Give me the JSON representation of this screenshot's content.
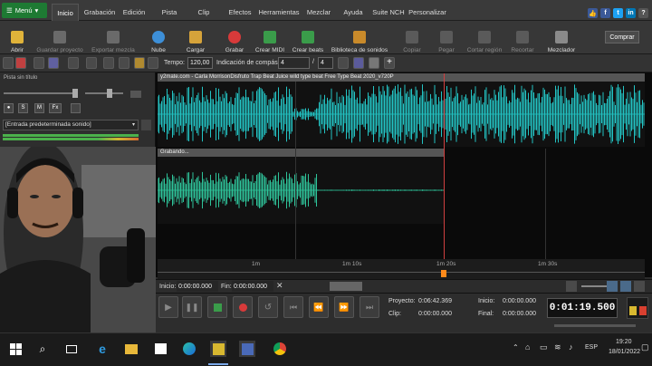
{
  "menubar": {
    "menu_label": "Menú",
    "tabs": [
      "Inicio",
      "Grabación",
      "Edición",
      "Pista",
      "Clip",
      "Efectos",
      "Herramientas",
      "Mezclar",
      "Ayuda",
      "Suite NCH",
      "Personalizar"
    ],
    "active_tab": "Inicio"
  },
  "ribbon": {
    "buttons": [
      {
        "label": "Abrir",
        "icon": "folder-open-icon",
        "enabled": true
      },
      {
        "label": "Guardar proyecto",
        "icon": "save-icon",
        "enabled": false
      },
      {
        "label": "Exportar mezcla",
        "icon": "export-icon",
        "enabled": false
      },
      {
        "label": "Nube",
        "icon": "cloud-icon",
        "enabled": true
      },
      {
        "label": "Cargar",
        "icon": "load-icon",
        "enabled": true
      },
      {
        "label": "Grabar",
        "icon": "record-icon",
        "enabled": true
      },
      {
        "label": "Crear MIDI",
        "icon": "midi-icon",
        "enabled": true
      },
      {
        "label": "Crear beats",
        "icon": "beats-icon",
        "enabled": true
      },
      {
        "label": "Biblioteca de sonidos",
        "icon": "sound-library-icon",
        "enabled": true
      },
      {
        "label": "Copiar",
        "icon": "copy-icon",
        "enabled": false
      },
      {
        "label": "Pegar",
        "icon": "paste-icon",
        "enabled": false
      },
      {
        "label": "Cortar región",
        "icon": "cut-region-icon",
        "enabled": false
      },
      {
        "label": "Recortar",
        "icon": "trim-icon",
        "enabled": false
      },
      {
        "label": "Mezclador",
        "icon": "mixer-icon",
        "enabled": true
      }
    ],
    "buy_label": "Comprar"
  },
  "toolbar": {
    "tempo_label": "Tempo:",
    "tempo_value": "120,00",
    "time_sig_label": "Indicación de compás:",
    "time_sig_num": "4",
    "time_sig_sep": "/",
    "time_sig_den": "4"
  },
  "left_panel": {
    "track_name": "Pista sin título",
    "input_device": "[Entrada predeterminada sonido]",
    "fx_label": "Fx",
    "solo_label": "S",
    "mute_label": "M"
  },
  "tracks": [
    {
      "title": "y2mate.com - Carla MorrisonDisfruto Trap Beat  Juice wild type beat  Free Type Beat 2020_v720P",
      "color": "#23c4c4"
    },
    {
      "title": "Grabando...",
      "color": "#2ec49a"
    }
  ],
  "ruler": {
    "labels": [
      "1m",
      "1m 10s",
      "1m 20s",
      "1m 30s"
    ]
  },
  "selection": {
    "start_label": "Inicio:",
    "start_value": "0:00:00.000",
    "end_label": "Fin:",
    "end_value": "0:00:00.000"
  },
  "transport": {
    "project_label": "Proyecto:",
    "project_value": "0:06:42.369",
    "clip_label": "Clip:",
    "clip_value": "0:00:00.000",
    "start_label": "Inicio:",
    "start_value": "0:00:00.000",
    "end_label": "Final:",
    "end_value": "0:00:00.000",
    "clock": "0:01:19.500"
  },
  "taskbar": {
    "lang": "ESP",
    "time": "19:20",
    "date": "18/01/2022"
  }
}
